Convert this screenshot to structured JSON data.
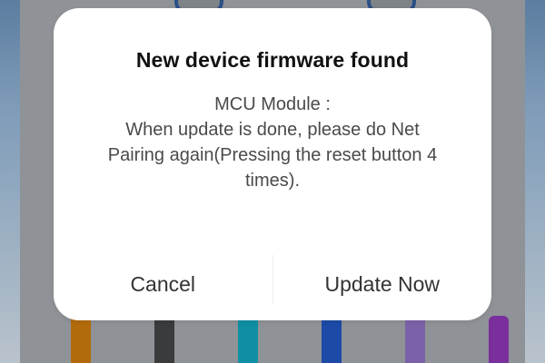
{
  "dialog": {
    "title": "New device firmware found",
    "message_lines": [
      "MCU Module :",
      "When update is done, please do Net",
      "Pairing again(Pressing the reset button 4",
      "times)."
    ],
    "cancel_label": "Cancel",
    "confirm_label": "Update Now"
  },
  "colors": {
    "background_overlay": "#8f9296",
    "dialog_bg": "#ffffff",
    "bar_colors": [
      "#b26b0c",
      "#3a3b3d",
      "#0f8ea4",
      "#1c4aa6",
      "#7b62a8",
      "#7a2f9c"
    ],
    "ring_color": "#2b4f86"
  }
}
